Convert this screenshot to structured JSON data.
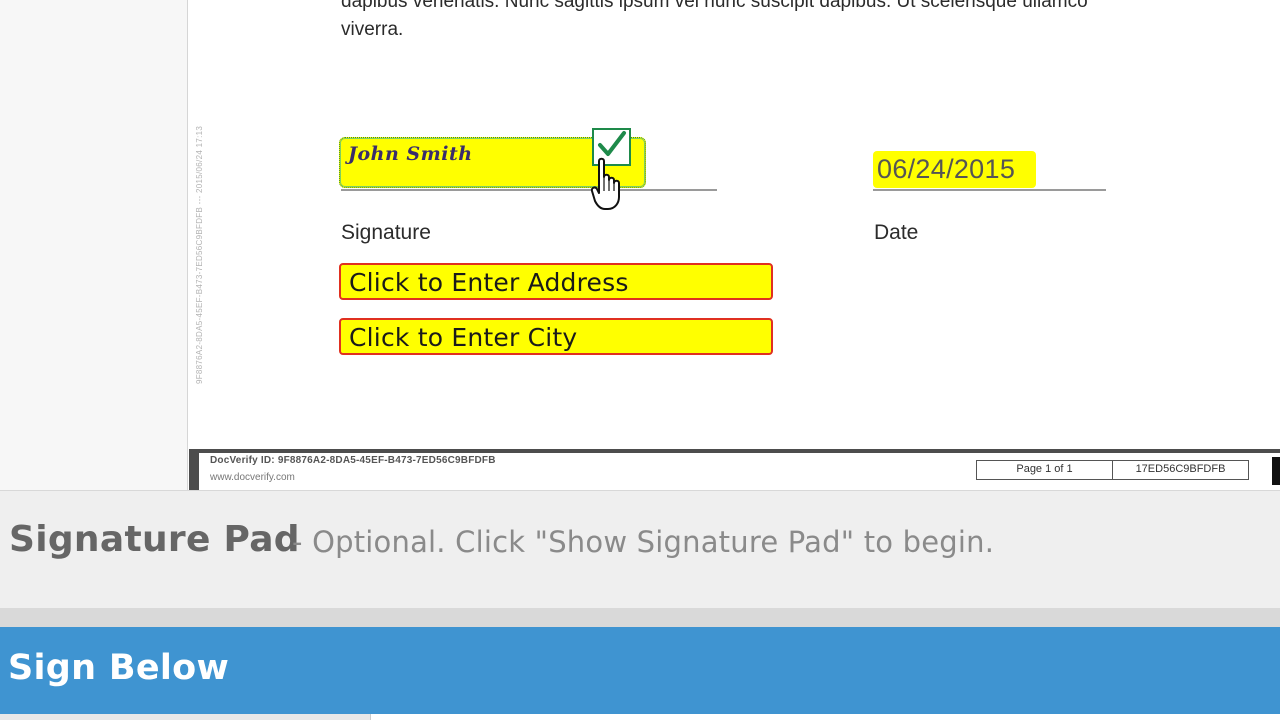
{
  "document": {
    "vertical_id": "9F8876A2-8DA5-45EF-B473-7ED56C9BFDFB --- 2015/06/24 17:13",
    "body_text": "dapibus venenatis. Nunc sagittis ipsum vel nunc suscipit dapibus. Ut scelerisque ullamco",
    "body_text_2": "viverra.",
    "signature_value": "John Smith",
    "signature_label": "Signature",
    "date_value": "06/24/2015",
    "date_label": "Date",
    "address_placeholder": "Click to Enter Address",
    "city_placeholder": "Click to Enter City"
  },
  "footer": {
    "docverify_id": "DocVerify ID: 9F8876A2-8DA5-45EF-B473-7ED56C9BFDFB",
    "url": "www.docverify.com",
    "page_indicator": "Page 1 of 1",
    "short_id": "17ED56C9BFDFB"
  },
  "signature_pad": {
    "title": "Signature Pad",
    "description": "- Optional. Click \"Show Signature Pad\" to begin."
  },
  "sign_below": {
    "title": "Sign Below"
  },
  "colors": {
    "field_fill": "#ffff00",
    "field_border": "#e03020",
    "check_green": "#1e8a4a",
    "header_blue": "#3f94d1"
  },
  "icons": {
    "checkbox": "check-icon",
    "cursor": "hand-pointer-icon"
  }
}
